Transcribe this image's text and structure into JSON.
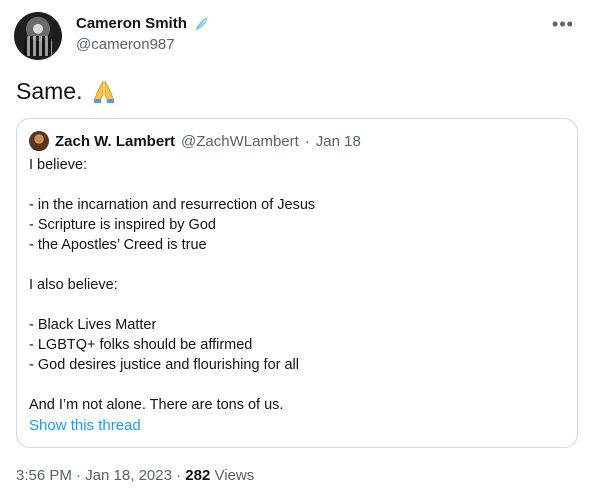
{
  "author": {
    "name": "Cameron Smith",
    "handle": "@cameron987",
    "badge_icon": "feather-icon",
    "avatar_icon": "avatar"
  },
  "more_icon": "more-horizontal-icon",
  "tweet": {
    "text": "Same.",
    "emoji_icon": "praying-hands-icon"
  },
  "quote": {
    "name": "Zach W. Lambert",
    "handle": "@ZachWLambert",
    "separator": "·",
    "date": "Jan 18",
    "lines": [
      "I believe:",
      "",
      "- in the incarnation and resurrection of Jesus",
      "- Scripture is inspired by God",
      "- the Apostles’ Creed is true",
      "",
      "I also believe:",
      "",
      "- Black Lives Matter",
      "- LGBTQ+ folks should be affirmed",
      "- God desires justice and flourishing for all",
      "",
      "And I’m not alone. There are tons of us."
    ],
    "show_thread": "Show this thread"
  },
  "footer": {
    "time": "3:56 PM · Jan 18, 2023 · ",
    "views_count": "282",
    "views_label": " Views"
  },
  "colors": {
    "link": "#1d9bf0",
    "muted": "#536471",
    "border": "#cfd9de"
  }
}
